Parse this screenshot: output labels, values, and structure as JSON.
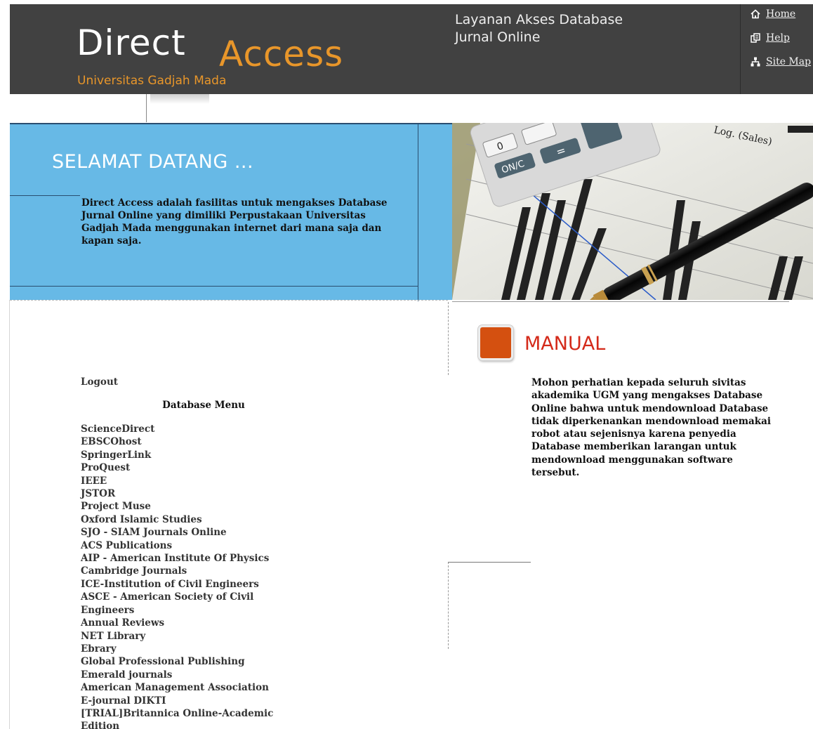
{
  "header": {
    "logo_direct": "Direct",
    "logo_access": "Access",
    "logo_university": "Universitas Gadjah Mada",
    "tagline_line1": "Layanan Akses Database",
    "tagline_line2": "Jurnal Online",
    "links": [
      {
        "label": "Home",
        "icon": "home-icon"
      },
      {
        "label": "Help",
        "icon": "help-icon"
      },
      {
        "label": "Site Map",
        "icon": "sitemap-icon"
      }
    ]
  },
  "banner": {
    "welcome": "SELAMAT DATANG ...",
    "intro": "Direct Access adalah fasilitas untuk mengakses Database Jurnal Online yang dimiliki Perpustakaan Universitas Gadjah Mada menggunakan internet dari mana saja dan kapan saja.",
    "photo_label": "Log. (Sales)",
    "calc_key_zero": "0",
    "calc_key_onc": "ON/C",
    "calc_key_equals": "=",
    "calc_key_plus": "+"
  },
  "sidebar": {
    "logout": "Logout",
    "menu_title": "Database Menu",
    "items": [
      "ScienceDirect",
      "EBSCOhost",
      "SpringerLink",
      "ProQuest",
      "IEEE",
      "JSTOR",
      "Project Muse",
      "Oxford Islamic Studies",
      "SJO - SIAM Journals Online",
      "ACS Publications",
      "AIP - American Institute Of Physics",
      "Cambridge Journals",
      "ICE-Institution of Civil Engineers",
      "ASCE - American Society of Civil",
      "Engineers",
      "Annual Reviews",
      "NET Library",
      "Ebrary",
      "Global Professional Publishing",
      "Emerald journals",
      "American Management Association",
      "E-journal DIKTI",
      "[TRIAL]Britannica Online-Academic",
      "Edition"
    ]
  },
  "manual": {
    "title": "MANUAL",
    "text": "Mohon perhatian kepada seluruh sivitas akademika UGM yang mengakses Database Online bahwa untuk mendownload Database tidak diperkenankan mendownload memakai robot atau sejenisnya karena penyedia Database memberikan larangan untuk mendownload menggunakan software tersebut."
  },
  "colors": {
    "header_bg": "#414141",
    "accent_orange": "#e8962a",
    "banner_blue": "#67b9e6",
    "manual_red": "#d42a1a",
    "manual_icon": "#d45010"
  }
}
